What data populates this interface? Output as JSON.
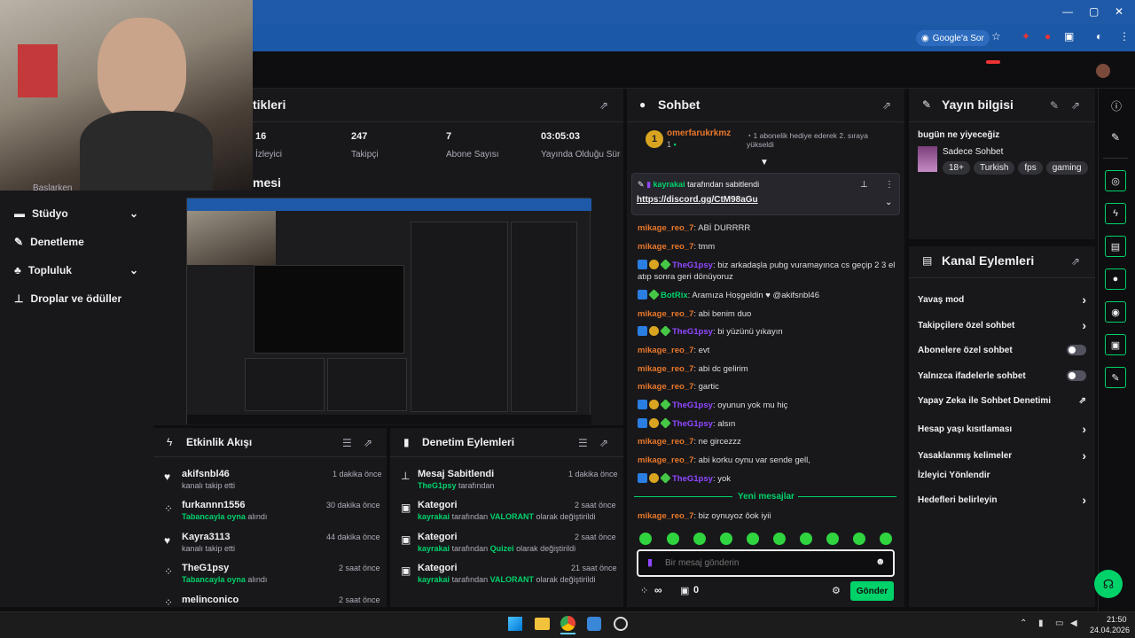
{
  "browser": {
    "google_sor": "Google'a Sor"
  },
  "stats": {
    "title_partial": "tikleri",
    "viewers": "16",
    "viewers_lbl": "İzleyici",
    "followers": "247",
    "followers_lbl": "Takipçi",
    "subs": "7",
    "subs_lbl": "Abone Sayısı",
    "duration": "03:05:03",
    "duration_lbl": "Yayında Olduğu Süre"
  },
  "preview": {
    "title_partial": "mesi"
  },
  "sidebar": {
    "items": [
      {
        "label": "Stüdyo",
        "chev": "⌄"
      },
      {
        "label": "Denetleme"
      },
      {
        "label": "Topluluk",
        "chev": "⌄"
      },
      {
        "label": "Droplar ve ödüller"
      }
    ],
    "partial": "Başlarken"
  },
  "activity": {
    "title": "Etkinlik Akışı",
    "items": [
      {
        "name": "akifsnbl46",
        "sub": "kanalı takip etti",
        "time": "1 dakika önce"
      },
      {
        "name": "furkannn1556",
        "sub_green": "Tabancayla oyna",
        "sub": "alındı",
        "time": "30 dakika önce"
      },
      {
        "name": "Kayra3113",
        "sub": "kanalı takip etti",
        "time": "44 dakika önce"
      },
      {
        "name": "TheG1psy",
        "sub_green": "Tabancayla oyna",
        "sub": "alındı",
        "time": "2 saat önce"
      },
      {
        "name": "melinconico",
        "time": "2 saat önce"
      }
    ]
  },
  "mod_actions": {
    "title": "Denetim Eylemleri",
    "items": [
      {
        "name": "Mesaj Sabitlendi",
        "user": "TheG1psy",
        "sub": "tarafından",
        "time": "1 dakika önce"
      },
      {
        "name": "Kategori",
        "user": "kayrakai",
        "sub": "tarafından",
        "game": "VALORANT",
        "sub2": "olarak değiştirildi",
        "time": "2 saat önce"
      },
      {
        "name": "Kategori",
        "user": "kayrakai",
        "sub": "tarafından",
        "game": "Quizei",
        "sub2": "olarak değiştirildi",
        "time": "2 saat önce"
      },
      {
        "name": "Kategori",
        "user": "kayrakai",
        "sub": "tarafından",
        "game": "VALORANT",
        "sub2": "olarak değiştirildi",
        "time": "21 saat önce"
      }
    ]
  },
  "chat": {
    "title": "Sohbet",
    "top_gifter": "omerfarukrkmz",
    "gifter_count": "1",
    "gift_msg": "1 abonelik hediye ederek 2. sıraya yükseldi",
    "pinned_by_user": "kayrakai",
    "pinned_by": "tarafından sabitlendi",
    "pinned_link": "https://discord.gg/CtM98aGu",
    "messages": [
      {
        "user": "mikage_reo_7",
        "text": ": ABİ DURRRR",
        "color": "orange"
      },
      {
        "user": "mikage_reo_7",
        "text": ": tmm",
        "color": "orange"
      },
      {
        "user": "TheG1psy",
        "text": ": biz arkadaşla pubg vuramayınca cs geçip 2 3 el atıp sonra geri dönüyoruz",
        "color": "purple",
        "badges": true
      },
      {
        "user": "BotRix",
        "text": ": Aramıza Hoşgeldin ♥ @akifsnbl46",
        "color": "green",
        "badges": true
      },
      {
        "user": "mikage_reo_7",
        "text": ": abi benim duo",
        "color": "orange"
      },
      {
        "user": "TheG1psy",
        "text": ": bi yüzünü yıkayın",
        "color": "purple",
        "badges": true
      },
      {
        "user": "mikage_reo_7",
        "text": ": evt",
        "color": "orange"
      },
      {
        "user": "mikage_reo_7",
        "text": ": abi dc gelirim",
        "color": "orange"
      },
      {
        "user": "mikage_reo_7",
        "text": ": gartic",
        "color": "orange"
      },
      {
        "user": "TheG1psy",
        "text": ": oyunun yok mu hiç",
        "color": "purple",
        "badges": true
      },
      {
        "user": "TheG1psy",
        "text": ": alsın",
        "color": "purple",
        "badges": true
      },
      {
        "user": "mikage_reo_7",
        "text": ": ne gircezzz",
        "color": "orange"
      },
      {
        "user": "mikage_reo_7",
        "text": ": abi korku oynu var sende gell,",
        "color": "orange"
      },
      {
        "user": "TheG1psy",
        "text": ": yok",
        "color": "purple",
        "badges": true
      }
    ],
    "new_messages": "Yeni mesajlar",
    "last": {
      "user": "mikage_reo_7",
      "text": ": biz oynuyoz ôok iyii"
    },
    "input_placeholder": "Bir mesaj gönderin",
    "points": "∞",
    "gift_count": "0",
    "send": "Gönder"
  },
  "stream_info": {
    "title": "Yayın bilgisi",
    "stream_title": "bugün ne yiyeceğiz",
    "category": "Sadece Sohbet",
    "tags": [
      "18+",
      "Turkish",
      "fps",
      "gaming"
    ]
  },
  "channel_actions": {
    "title": "Kanal Eylemleri",
    "items": [
      {
        "label": "Yavaş mod",
        "ctrl": "chev"
      },
      {
        "label": "Takipçilere özel sohbet",
        "ctrl": "chev"
      },
      {
        "label": "Abonelere özel sohbet",
        "ctrl": "toggle"
      },
      {
        "label": "Yalnızca ifadelerle sohbet",
        "ctrl": "toggle"
      },
      {
        "label": "Yapay Zeka ile Sohbet Denetimi",
        "ctrl": "ext"
      },
      {
        "label": "Hesap yaşı kısıtlaması",
        "ctrl": "chev"
      },
      {
        "label": "Yasaklanmış kelimeler",
        "ctrl": "chev"
      },
      {
        "label": "İzleyici Yönlendir",
        "ctrl": "none"
      },
      {
        "label": "Hedefleri belirleyin",
        "ctrl": "chev"
      }
    ]
  },
  "taskbar": {
    "time": "21:50",
    "date": "24.04.2026"
  },
  "colors": {
    "green": "#00d26a",
    "panel": "#18181b",
    "bg": "#0e0e10",
    "accent_blue": "#1e5aa8"
  }
}
